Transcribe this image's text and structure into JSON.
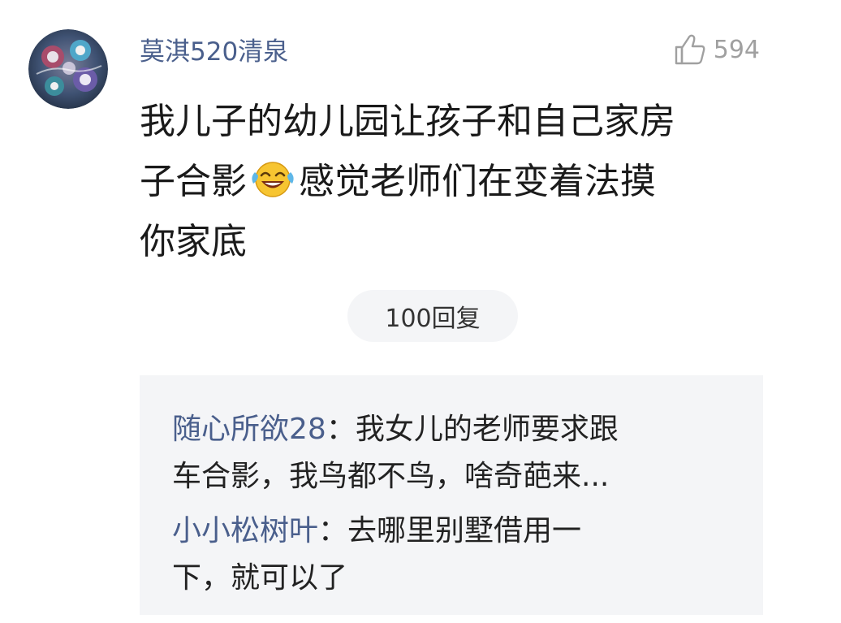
{
  "comment": {
    "username": "莫淇520清泉",
    "like_count": "594",
    "text_lines": [
      "我儿子的幼儿园让孩子和自己家房",
      "子合影",
      "感觉老师们在变着法摸",
      "你家底"
    ],
    "emoji": "laughing-crying-emoji",
    "reply_count_label": "100回复"
  },
  "replies": [
    {
      "username": "随心所欲28",
      "separator": "：",
      "line1": "我女儿的老师要求跟",
      "line2": "车合影，我鸟都不鸟，啥奇葩来..."
    },
    {
      "username": "小小松树叶",
      "separator": "：",
      "line1": "去哪里别墅借用一",
      "line2": "下，就可以了"
    }
  ],
  "colors": {
    "username": "#4a5f8c",
    "like": "#a0a0a0",
    "reply_bg": "#f4f5f7",
    "text": "#1a1a1a"
  }
}
